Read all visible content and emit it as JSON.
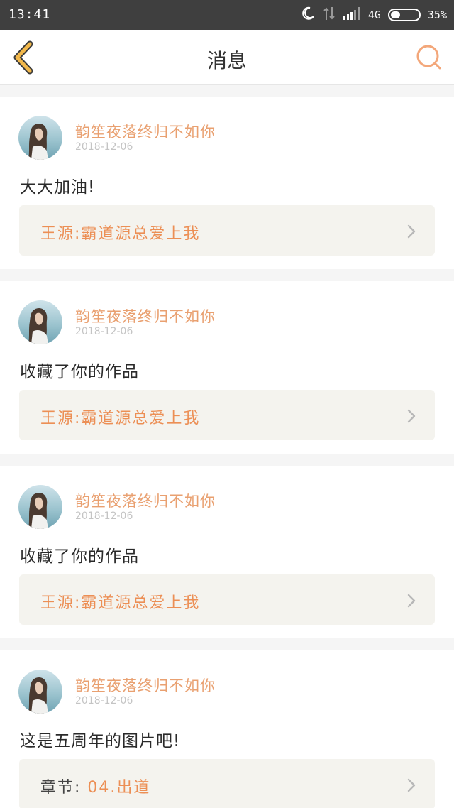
{
  "status_bar": {
    "time": "13:41",
    "network": "4G",
    "battery_percent": "35%",
    "battery_level": 0.35,
    "icons": [
      "moon-icon",
      "data-transfer-icon",
      "signal-icon",
      "battery-icon"
    ]
  },
  "header": {
    "title": "消息",
    "back_icon": "chevron-left-icon",
    "search_icon": "search-icon",
    "accent_color": "#f2b84b",
    "search_color": "#f3a77a"
  },
  "messages": [
    {
      "username": "韵笙夜落终归不如你",
      "date": "2018-12-06",
      "text": "大大加油!",
      "ref_label": "",
      "ref_title": "王源:霸道源总爱上我"
    },
    {
      "username": "韵笙夜落终归不如你",
      "date": "2018-12-06",
      "text": "收藏了你的作品",
      "ref_label": "",
      "ref_title": "王源:霸道源总爱上我"
    },
    {
      "username": "韵笙夜落终归不如你",
      "date": "2018-12-06",
      "text": "收藏了你的作品",
      "ref_label": "",
      "ref_title": "王源:霸道源总爱上我"
    },
    {
      "username": "韵笙夜落终归不如你",
      "date": "2018-12-06",
      "text": "这是五周年的图片吧!",
      "ref_label": "章节: ",
      "ref_title": "04.出道"
    }
  ],
  "colors": {
    "username": "#e9a070",
    "ref_title": "#ec8f55",
    "ref_background": "#f4f3ee",
    "status_bar": "#3f3f3f"
  }
}
